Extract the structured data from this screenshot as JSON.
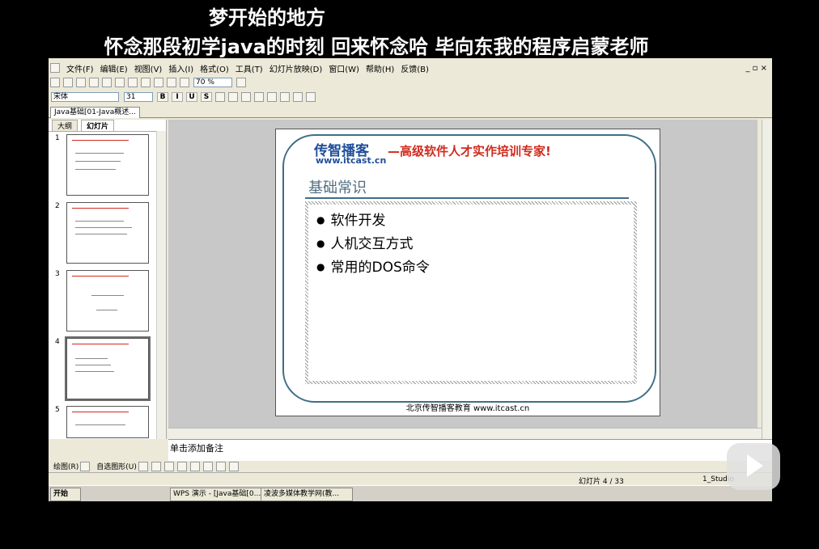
{
  "overlay": {
    "line1": "梦开始的地方",
    "line2": "怀念那段初学java的时刻 回来怀念哈 毕向东我的程序启蒙老师"
  },
  "menu": [
    "文件(F)",
    "编辑(E)",
    "视图(V)",
    "插入(I)",
    "格式(O)",
    "工具(T)",
    "幻灯片放映(D)",
    "窗口(W)",
    "帮助(H)",
    "反馈(B)"
  ],
  "toolbar": {
    "zoom": "70 %",
    "font": "宋体",
    "size": "31"
  },
  "document_tab": "Java基础[01-Java概述...",
  "left_panel": {
    "tab_outline": "大纲",
    "tab_slides": "幻灯片",
    "thumb_numbers": [
      "1",
      "2",
      "3",
      "4",
      "5"
    ]
  },
  "slide": {
    "logo": "传智播客",
    "logo_url": "www.itcast.cn",
    "slogan": "—高级软件人才实作培训专家!",
    "title": "基础常识",
    "bullets": [
      "软件开发",
      "人机交互方式",
      "常用的DOS命令"
    ],
    "footer": "北京传智播客教育 www.itcast.cn"
  },
  "notes": {
    "placeholder": "单击添加备注"
  },
  "drawbar": {
    "draw": "绘图(R)",
    "autoshapes": "自选图形(U)"
  },
  "status": {
    "slide_counter": "幻灯片 4 / 33",
    "theme": "1_Studio"
  },
  "taskbar": {
    "start": "开始",
    "task1": "WPS 演示 - [Java基础[0...",
    "task2": "凌波多媒体教学网(教..."
  }
}
